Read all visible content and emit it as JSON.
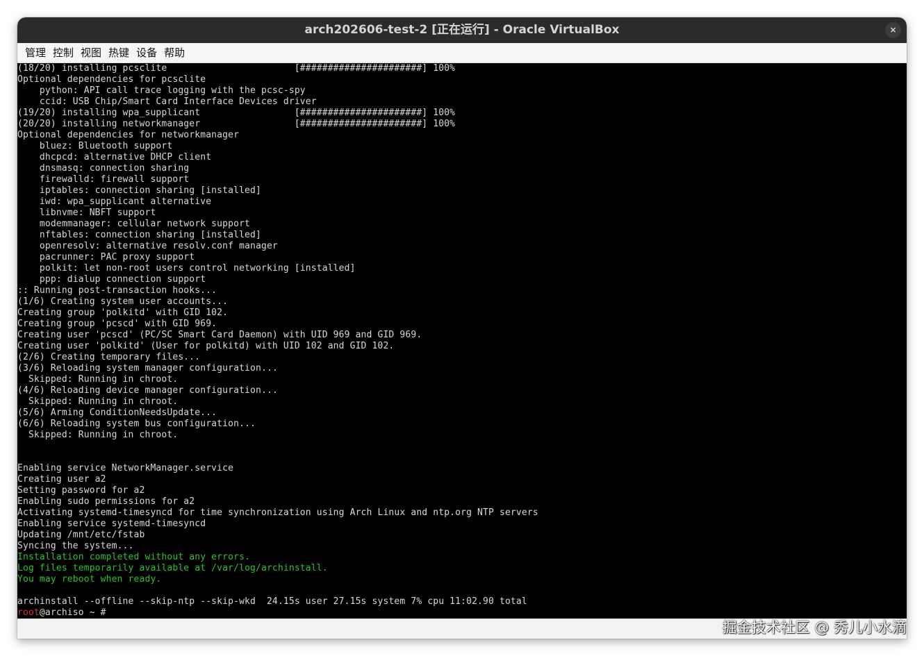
{
  "window": {
    "title": "arch202606-test-2 [正在运行] - Oracle VirtualBox",
    "close_label": "×"
  },
  "menubar": {
    "items": [
      "管理",
      "控制",
      "视图",
      "热键",
      "设备",
      "帮助"
    ]
  },
  "terminal": {
    "lines": [
      {
        "text": "(18/20) installing pcsclite                       [######################] 100%",
        "color": "white"
      },
      {
        "text": "Optional dependencies for pcsclite",
        "color": "white"
      },
      {
        "text": "    python: API call trace logging with the pcsc-spy",
        "color": "white"
      },
      {
        "text": "    ccid: USB Chip/Smart Card Interface Devices driver",
        "color": "white"
      },
      {
        "text": "(19/20) installing wpa_supplicant                 [######################] 100%",
        "color": "white"
      },
      {
        "text": "(20/20) installing networkmanager                 [######################] 100%",
        "color": "white"
      },
      {
        "text": "Optional dependencies for networkmanager",
        "color": "white"
      },
      {
        "text": "    bluez: Bluetooth support",
        "color": "white"
      },
      {
        "text": "    dhcpcd: alternative DHCP client",
        "color": "white"
      },
      {
        "text": "    dnsmasq: connection sharing",
        "color": "white"
      },
      {
        "text": "    firewalld: firewall support",
        "color": "white"
      },
      {
        "text": "    iptables: connection sharing [installed]",
        "color": "white"
      },
      {
        "text": "    iwd: wpa_supplicant alternative",
        "color": "white"
      },
      {
        "text": "    libnvme: NBFT support",
        "color": "white"
      },
      {
        "text": "    modemmanager: cellular network support",
        "color": "white"
      },
      {
        "text": "    nftables: connection sharing [installed]",
        "color": "white"
      },
      {
        "text": "    openresolv: alternative resolv.conf manager",
        "color": "white"
      },
      {
        "text": "    pacrunner: PAC proxy support",
        "color": "white"
      },
      {
        "text": "    polkit: let non-root users control networking [installed]",
        "color": "white"
      },
      {
        "text": "    ppp: dialup connection support",
        "color": "white"
      },
      {
        "text": ":: Running post-transaction hooks...",
        "color": "white"
      },
      {
        "text": "(1/6) Creating system user accounts...",
        "color": "white"
      },
      {
        "text": "Creating group 'polkitd' with GID 102.",
        "color": "white"
      },
      {
        "text": "Creating group 'pcscd' with GID 969.",
        "color": "white"
      },
      {
        "text": "Creating user 'pcscd' (PC/SC Smart Card Daemon) with UID 969 and GID 969.",
        "color": "white"
      },
      {
        "text": "Creating user 'polkitd' (User for polkitd) with UID 102 and GID 102.",
        "color": "white"
      },
      {
        "text": "(2/6) Creating temporary files...",
        "color": "white"
      },
      {
        "text": "(3/6) Reloading system manager configuration...",
        "color": "white"
      },
      {
        "text": "  Skipped: Running in chroot.",
        "color": "white"
      },
      {
        "text": "(4/6) Reloading device manager configuration...",
        "color": "white"
      },
      {
        "text": "  Skipped: Running in chroot.",
        "color": "white"
      },
      {
        "text": "(5/6) Arming ConditionNeedsUpdate...",
        "color": "white"
      },
      {
        "text": "(6/6) Reloading system bus configuration...",
        "color": "white"
      },
      {
        "text": "  Skipped: Running in chroot.",
        "color": "white"
      },
      {
        "text": "",
        "color": "white"
      },
      {
        "text": "",
        "color": "white"
      },
      {
        "text": "Enabling service NetworkManager.service",
        "color": "white"
      },
      {
        "text": "Creating user a2",
        "color": "white"
      },
      {
        "text": "Setting password for a2",
        "color": "white"
      },
      {
        "text": "Enabling sudo permissions for a2",
        "color": "white"
      },
      {
        "text": "Activating systemd-timesyncd for time synchronization using Arch Linux and ntp.org NTP servers",
        "color": "white"
      },
      {
        "text": "Enabling service systemd-timesyncd",
        "color": "white"
      },
      {
        "text": "Updating /mnt/etc/fstab",
        "color": "white"
      },
      {
        "text": "Syncing the system...",
        "color": "white"
      },
      {
        "text": "Installation completed without any errors.",
        "color": "green"
      },
      {
        "text": "Log files temporarily available at /var/log/archinstall.",
        "color": "green"
      },
      {
        "text": "You may reboot when ready.",
        "color": "green"
      },
      {
        "text": "",
        "color": "white"
      },
      {
        "text": "archinstall --offline --skip-ntp --skip-wkd  24.15s user 27.15s system 7% cpu 11:02.90 total",
        "color": "white"
      }
    ],
    "prompt": {
      "user": "root",
      "rest": "@archiso ~ # "
    }
  },
  "watermark": "掘金技术社区 @ 秀儿小水滴",
  "colors": {
    "terminal_bg": "#000000",
    "terminal_fg": "#d9d9d9",
    "success_green": "#2fbf2f",
    "prompt_red": "#e03030",
    "titlebar_bg": "#2b2b2b"
  }
}
